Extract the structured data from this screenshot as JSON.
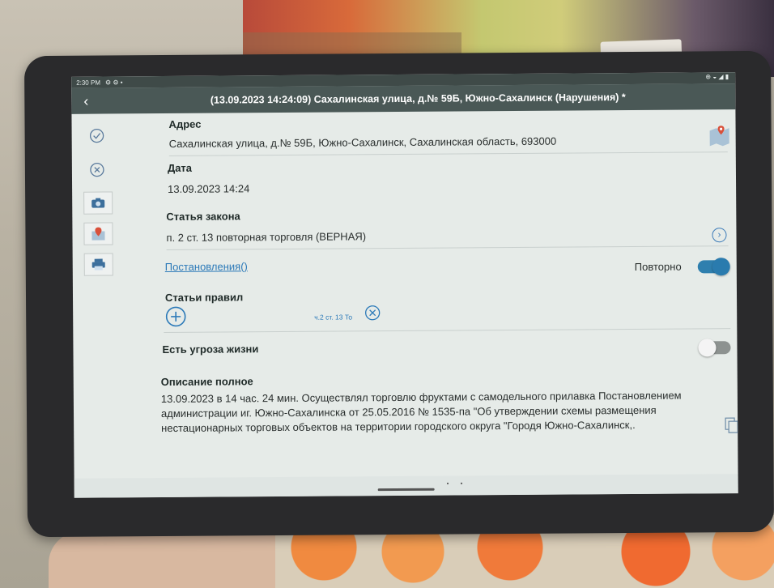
{
  "status_bar": {
    "time": "2:30 PM",
    "right": "⊕ ◒ ◢ ▮"
  },
  "title_bar": {
    "back": "‹",
    "title": "(13.09.2023 14:24:09) Сахалинская улица, д.№ 59Б, Южно-Сахалинск (Нарушения) *"
  },
  "sidebar": {
    "confirm": "✓",
    "cancel": "✕"
  },
  "form": {
    "address_label": "Адрес",
    "address_value": "Сахалинская улица, д.№ 59Б, Южно-Сахалинск, Сахалинская область, 693000",
    "date_label": "Дата",
    "date_value": "13.09.2023 14:24",
    "law_label": "Статья закона",
    "law_value": "п. 2 ст. 13 повторная торговля (ВЕРНАЯ)",
    "decrees_link": "Постановления()",
    "repeat_label": "Повторно",
    "repeat_on": true,
    "rules_label": "Статьи правил",
    "add": "+",
    "rule_chip": "ч.2 ст. 13 То",
    "remove": "✕",
    "threat_label": "Есть угроза жизни",
    "threat_on": false,
    "description_label": "Описание полное",
    "description_value": "13.09.2023 в 14 час. 24 мин. Осуществлял торговлю фруктами с самодельного прилавка  Постановлением администрации иг. Южно-Сахалинска от 25.05.2016 № 1535-па \"Об утверждении схемы размещения нестационарных торговых объектов на территории городского округа \"Городя Южно-Сахалинск,."
  },
  "colors": {
    "accent": "#2b79b8",
    "toggle_on": "#2f7fae",
    "header": "#4a5856"
  },
  "icons": [
    "check-circle-icon",
    "close-circle-icon",
    "camera-icon",
    "map-pin-icon",
    "printer-icon",
    "map-icon",
    "chevron-right-icon",
    "add-circle-icon",
    "remove-circle-icon",
    "copy-document-icon"
  ]
}
